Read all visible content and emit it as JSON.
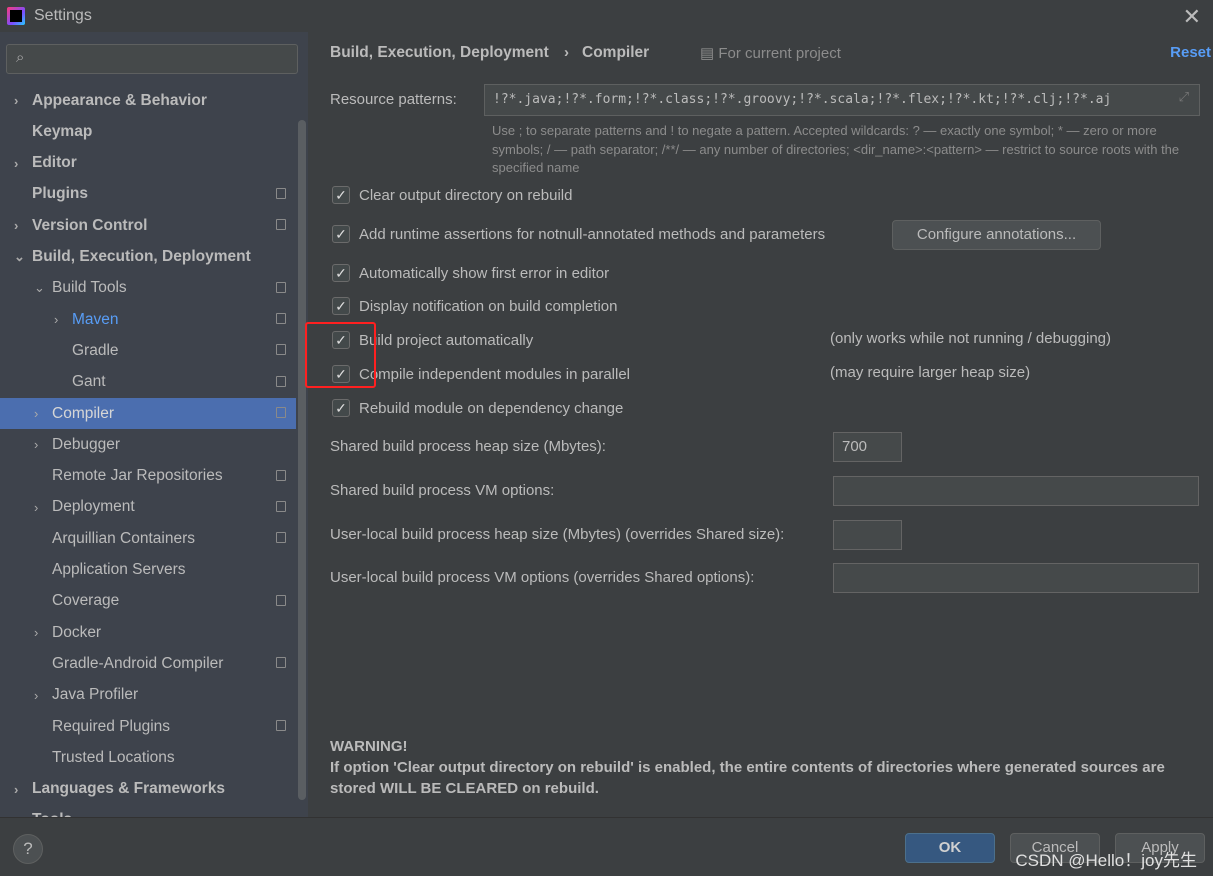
{
  "window": {
    "title": "Settings"
  },
  "search": {
    "placeholder": ""
  },
  "sidebar": {
    "items": [
      {
        "label": "Appearance & Behavior",
        "bold": true,
        "chev": "›",
        "level": 0
      },
      {
        "label": "Keymap",
        "bold": true,
        "level": 0
      },
      {
        "label": "Editor",
        "bold": true,
        "chev": "›",
        "level": 0
      },
      {
        "label": "Plugins",
        "bold": true,
        "level": 0,
        "icon": true
      },
      {
        "label": "Version Control",
        "bold": true,
        "chev": "›",
        "level": 0,
        "icon": true
      },
      {
        "label": "Build, Execution, Deployment",
        "bold": true,
        "chev": "⌄",
        "level": 0
      },
      {
        "label": "Build Tools",
        "chev": "⌄",
        "level": 1,
        "icon": true
      },
      {
        "label": "Maven",
        "chev": "›",
        "level": 2,
        "icon": true,
        "link": true
      },
      {
        "label": "Gradle",
        "level": 2,
        "icon": true
      },
      {
        "label": "Gant",
        "level": 2,
        "icon": true
      },
      {
        "label": "Compiler",
        "chev": "›",
        "level": 1,
        "icon": true,
        "selected": true
      },
      {
        "label": "Debugger",
        "chev": "›",
        "level": 1
      },
      {
        "label": "Remote Jar Repositories",
        "level": 1,
        "icon": true
      },
      {
        "label": "Deployment",
        "chev": "›",
        "level": 1,
        "icon": true
      },
      {
        "label": "Arquillian Containers",
        "level": 1,
        "icon": true
      },
      {
        "label": "Application Servers",
        "level": 1
      },
      {
        "label": "Coverage",
        "level": 1,
        "icon": true
      },
      {
        "label": "Docker",
        "chev": "›",
        "level": 1
      },
      {
        "label": "Gradle-Android Compiler",
        "level": 1,
        "icon": true
      },
      {
        "label": "Java Profiler",
        "chev": "›",
        "level": 1
      },
      {
        "label": "Required Plugins",
        "level": 1,
        "icon": true
      },
      {
        "label": "Trusted Locations",
        "level": 1
      },
      {
        "label": "Languages & Frameworks",
        "bold": true,
        "chev": "›",
        "level": 0
      },
      {
        "label": "Tools",
        "bold": true,
        "chev": "›",
        "level": 0
      }
    ]
  },
  "header": {
    "breadcrumb_parent": "Build, Execution, Deployment",
    "separator": "›",
    "breadcrumb_current": "Compiler",
    "scope": "For current project",
    "reset": "Reset"
  },
  "resource": {
    "label": "Resource patterns:",
    "value": "!?*.java;!?*.form;!?*.class;!?*.groovy;!?*.scala;!?*.flex;!?*.kt;!?*.clj;!?*.aj",
    "help": "Use ; to separate patterns and ! to negate a pattern. Accepted wildcards: ? — exactly one symbol; * — zero or more symbols; / — path separator; /**/ — any number of directories; <dir_name>:<pattern> — restrict to source roots with the specified name"
  },
  "options": [
    {
      "label": "Clear output directory on rebuild",
      "checked": true
    },
    {
      "label": "Add runtime assertions for notnull-annotated methods and parameters",
      "checked": true
    },
    {
      "label": "Automatically show first error in editor",
      "checked": true
    },
    {
      "label": "Display notification on build completion",
      "checked": true
    },
    {
      "label": "Build project automatically",
      "checked": true,
      "note": "(only works while not running / debugging)"
    },
    {
      "label": "Compile independent modules in parallel",
      "checked": true,
      "note": "(may require larger heap size)"
    },
    {
      "label": "Rebuild module on dependency change",
      "checked": true
    }
  ],
  "configure_button": "Configure annotations...",
  "fields": [
    {
      "label": "Shared build process heap size (Mbytes):",
      "value": "700"
    },
    {
      "label": "Shared build process VM options:",
      "value": ""
    },
    {
      "label": "User-local build process heap size (Mbytes) (overrides Shared size):",
      "value": ""
    },
    {
      "label": "User-local build process VM options (overrides Shared options):",
      "value": ""
    }
  ],
  "warning": {
    "title": "WARNING!",
    "text": "If option 'Clear output directory on rebuild' is enabled, the entire contents of directories where generated sources are stored WILL BE CLEARED on rebuild."
  },
  "footer": {
    "help": "?",
    "ok": "OK",
    "cancel": "Cancel",
    "apply": "Apply"
  },
  "watermark": "CSDN @Hello！joy先生",
  "colors": {
    "accent": "#4b6eaf",
    "link": "#589df6",
    "highlight": "#ff2020"
  }
}
